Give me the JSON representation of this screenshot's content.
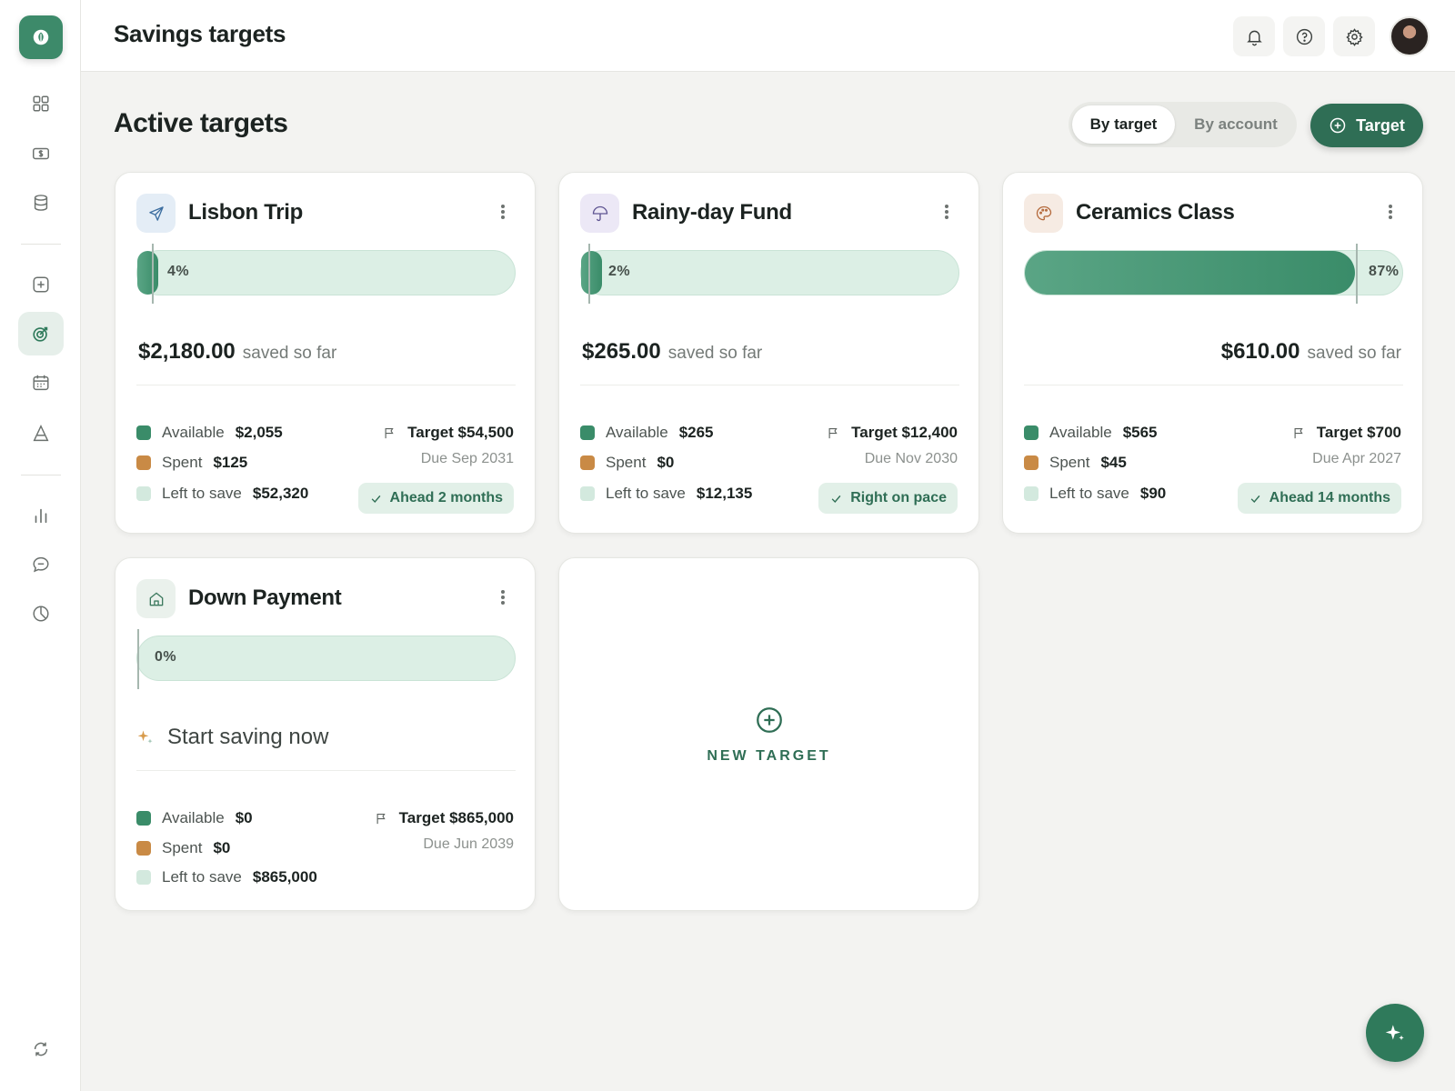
{
  "header": {
    "title": "Savings targets"
  },
  "section": {
    "title": "Active targets"
  },
  "view_toggle": {
    "by_target": "By target",
    "by_account": "By account",
    "selected": "By target"
  },
  "add_button": {
    "label": "Target"
  },
  "stat_labels": {
    "available": "Available",
    "spent": "Spent",
    "left": "Left to save"
  },
  "colors": {
    "accent": "#2f6e55",
    "available": "#3a8c69",
    "spent": "#c98a45",
    "left": "#d3e9de",
    "track": "#dcefe5"
  },
  "cards": [
    {
      "title": "Lisbon Trip",
      "icon": "paper-plane-icon",
      "percent_label": "4%",
      "progress": 0.04,
      "saved_amount": "$2,180.00",
      "saved_suffix": "saved so far",
      "available": "$2,055",
      "spent": "$125",
      "left": "$52,320",
      "target": "Target $54,500",
      "due": "Due Sep 2031",
      "pace": "Ahead 2 months"
    },
    {
      "title": "Rainy-day Fund",
      "icon": "umbrella-icon",
      "percent_label": "2%",
      "progress": 0.02,
      "saved_amount": "$265.00",
      "saved_suffix": "saved so far",
      "available": "$265",
      "spent": "$0",
      "left": "$12,135",
      "target": "Target $12,400",
      "due": "Due Nov 2030",
      "pace": "Right on pace"
    },
    {
      "title": "Ceramics Class",
      "icon": "palette-icon",
      "percent_label": "87%",
      "progress": 0.87,
      "saved_amount": "$610.00",
      "saved_suffix": "saved so far",
      "available": "$565",
      "spent": "$45",
      "left": "$90",
      "target": "Target $700",
      "due": "Due Apr 2027",
      "pace": "Ahead 14 months"
    },
    {
      "title": "Down Payment",
      "icon": "house-icon",
      "percent_label": "0%",
      "progress": 0,
      "start_text": "Start saving now",
      "available": "$0",
      "spent": "$0",
      "left": "$865,000",
      "target": "Target $865,000",
      "due": "Due Jun 2039"
    }
  ],
  "new_target": {
    "label": "NEW TARGET"
  }
}
